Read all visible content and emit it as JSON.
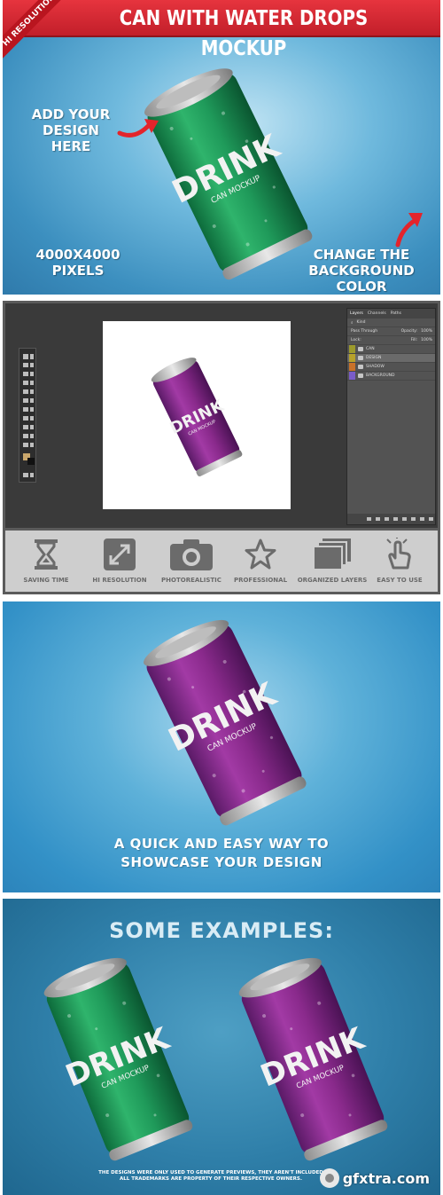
{
  "header": {
    "title": "CAN WITH WATER DROPS MOCKUP",
    "ribbon": "HI RESOLUTION"
  },
  "panel1": {
    "add_design": [
      "ADD YOUR",
      "DESIGN HERE"
    ],
    "resolution": [
      "4000X4000",
      "PIXELS"
    ],
    "change_bg": [
      "CHANGE THE",
      "BACKGROUND COLOR"
    ],
    "can": {
      "label_big": "DRINK",
      "label_small": "CAN MOCKUP",
      "color": "#1f9a5a"
    }
  },
  "photoshop": {
    "tabs": [
      "Layers",
      "Channels",
      "Paths"
    ],
    "kind_label": "Kind",
    "blend_mode": "Pass Through",
    "opacity_label": "Opacity:",
    "opacity_value": "100%",
    "lock_label": "Lock:",
    "fill_label": "Fill:",
    "fill_value": "100%",
    "layers": [
      {
        "name": "CAN",
        "eye_color": "#9c9a2c"
      },
      {
        "name": "DESIGN",
        "eye_color": "#b8a22a"
      },
      {
        "name": "SHADOW",
        "eye_color": "#c9722a"
      },
      {
        "name": "BACKGROUND",
        "eye_color": "#7a5cc8"
      }
    ],
    "canvas_can": {
      "label_big": "DRINK",
      "label_small": "CAN MOCKUP",
      "color": "#8a2a8c"
    }
  },
  "features": [
    {
      "label": "SAVING TIME",
      "icon": "hourglass-icon"
    },
    {
      "label": "HI RESOLUTION",
      "icon": "expand-arrows-icon"
    },
    {
      "label": "PHOTOREALISTIC",
      "icon": "camera-icon"
    },
    {
      "label": "PROFESSIONAL",
      "icon": "star-icon"
    },
    {
      "label": "ORGANIZED LAYERS",
      "icon": "layers-icon"
    },
    {
      "label": "EASY TO USE",
      "icon": "hand-pointer-icon"
    }
  ],
  "panel3": {
    "tagline": [
      "A QUICK AND EASY WAY TO",
      "SHOWCASE YOUR DESIGN"
    ],
    "can": {
      "label_big": "DRINK",
      "label_small": "CAN MOCKUP",
      "color": "#8a2a8c"
    }
  },
  "panel4": {
    "title": "SOME EXAMPLES:",
    "can_left": {
      "label_big": "DRINK",
      "label_small": "CAN MOCKUP",
      "color": "#1f9a5a"
    },
    "can_right": {
      "label_big": "DRINK",
      "label_small": "CAN MOCKUP",
      "color": "#8a2a8c"
    },
    "disclaimer": [
      "THE DESIGNS WERE ONLY USED TO GENERATE PREVIEWS, THEY AREN'T INCLUDED",
      "ALL TRADEMARKS ARE PROPERTY OF THEIR RESPECTIVE OWNERS."
    ],
    "watermark": "gfxtra.com"
  }
}
